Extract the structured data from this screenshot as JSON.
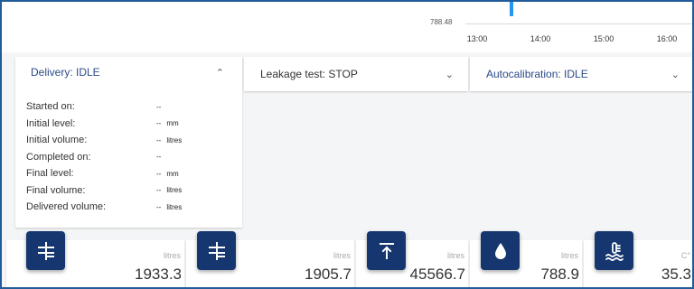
{
  "chart": {
    "y_tick": "788.48",
    "x_ticks": [
      "13:00",
      "14:00",
      "15:00",
      "16:00"
    ]
  },
  "panels": {
    "delivery": {
      "title": "Delivery: IDLE",
      "expanded": true,
      "rows": [
        {
          "label": "Started on:",
          "value": "--",
          "unit": ""
        },
        {
          "label": "Initial level:",
          "value": "--",
          "unit": "mm"
        },
        {
          "label": "Initial volume:",
          "value": "--",
          "unit": "litres"
        },
        {
          "label": "Completed on:",
          "value": "--",
          "unit": ""
        },
        {
          "label": "Final level:",
          "value": "--",
          "unit": "mm"
        },
        {
          "label": "Final volume:",
          "value": "--",
          "unit": "litres"
        },
        {
          "label": "Delivered volume:",
          "value": "--",
          "unit": "litres"
        }
      ]
    },
    "leakage": {
      "title": "Leakage test: STOP"
    },
    "autocalibration": {
      "title": "Autocalibration: IDLE"
    }
  },
  "cards": [
    {
      "icon": "gross-volume-icon",
      "unit": "litres",
      "value": "1933.3"
    },
    {
      "icon": "net-volume-icon",
      "unit": "litres",
      "value": "1905.7"
    },
    {
      "icon": "ullage-icon",
      "unit": "litres",
      "value": "45566.7"
    },
    {
      "icon": "water-drop-icon",
      "unit": "litres",
      "value": "788.9"
    },
    {
      "icon": "temperature-icon",
      "unit": "C°",
      "value": "35.3"
    }
  ],
  "colors": {
    "accent": "#16366f",
    "title_blue": "#2b4a8a",
    "chart_marker": "#2196f3"
  }
}
